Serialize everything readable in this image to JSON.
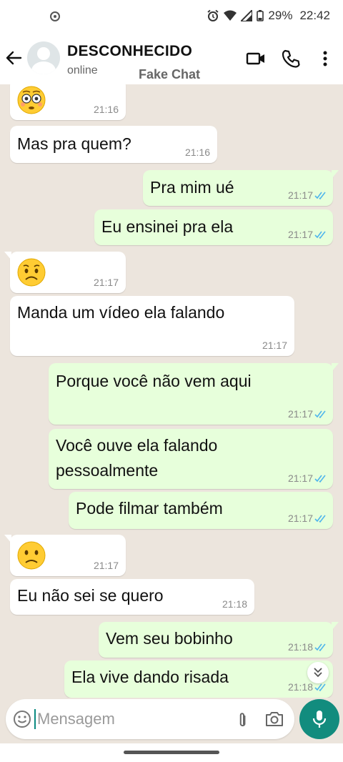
{
  "status_bar": {
    "battery": "29%",
    "clock": "22:42",
    "icons": [
      "camera-dot-icon",
      "alarm-icon",
      "wifi-icon",
      "signal-icon",
      "battery-icon"
    ]
  },
  "header": {
    "contact_name": "DESCONHECIDO",
    "contact_status": "online",
    "watermark": "Fake Chat",
    "icons": [
      "back-arrow-icon",
      "video-call-icon",
      "phone-call-icon",
      "more-options-icon"
    ]
  },
  "messages": [
    {
      "direction": "in",
      "emoji": "flushed-face",
      "time": "21:16"
    },
    {
      "direction": "in",
      "text": "Mas pra quem?",
      "time": "21:16"
    },
    {
      "direction": "out",
      "text": "Pra mim ué",
      "time": "21:17",
      "status": "read"
    },
    {
      "direction": "out",
      "text": "Eu ensinei pra ela",
      "time": "21:17",
      "status": "read"
    },
    {
      "direction": "in",
      "emoji": "worried-face",
      "time": "21:17"
    },
    {
      "direction": "in",
      "text": "Manda um vídeo ela falando",
      "time": "21:17"
    },
    {
      "direction": "out",
      "text": "Porque você não vem aqui",
      "time": "21:17",
      "status": "read"
    },
    {
      "direction": "out",
      "text_line1": "Você ouve ela falando",
      "text_line2": "pessoalmente",
      "time": "21:17",
      "status": "read"
    },
    {
      "direction": "out",
      "text": "Pode filmar também",
      "time": "21:17",
      "status": "read"
    },
    {
      "direction": "in",
      "emoji": "slightly-frowning-face",
      "time": "21:17"
    },
    {
      "direction": "in",
      "text": "Eu não sei se quero",
      "time": "21:18"
    },
    {
      "direction": "out",
      "text": "Vem seu bobinho",
      "time": "21:18",
      "status": "read"
    },
    {
      "direction": "out",
      "text": "Ela vive dando risada",
      "time": "21:18",
      "status": "read"
    }
  ],
  "composer": {
    "placeholder": "Mensagem",
    "value": ""
  },
  "colors": {
    "chat_background": "#ece5dd",
    "incoming_bubble": "#ffffff",
    "outgoing_bubble": "#e7ffdb",
    "accent": "#128c7e",
    "read_ticks": "#4fb6ec"
  }
}
